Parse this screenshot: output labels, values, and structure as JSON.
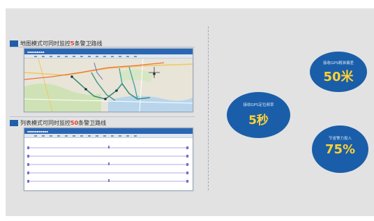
{
  "section_map": {
    "caption_prefix": "地图模式可同时监控",
    "caption_count": "5",
    "caption_suffix": "条警卫路线"
  },
  "section_list": {
    "caption_prefix": "列表模式可同时监控",
    "caption_count": "50",
    "caption_suffix": "条警卫路线"
  },
  "stats": {
    "report": {
      "label": "接收GPS定位频率",
      "value": "5秒"
    },
    "accuracy": {
      "label": "接收GPS精准偏差",
      "value": "50米"
    },
    "saving": {
      "label": "节省警力投入",
      "value": "75%"
    }
  },
  "colors": {
    "accent_blue": "#1a5ea9",
    "value_yellow": "#ffd233",
    "highlight_red": "#e33a2a"
  }
}
